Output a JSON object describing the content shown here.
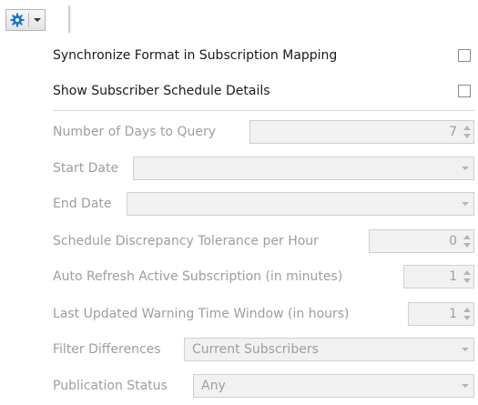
{
  "toolbar": {
    "gear_icon": "gear-icon",
    "dropdown_icon": "chevron-down-icon",
    "accent": "#1e73c8"
  },
  "options": {
    "sync_format": {
      "label": "Synchronize Format in Subscription Mapping",
      "checked": false
    },
    "show_schedule": {
      "label": "Show Subscriber Schedule Details",
      "checked": false
    }
  },
  "fields": {
    "days_to_query": {
      "label": "Number of Days to Query",
      "value": "7"
    },
    "start_date": {
      "label": "Start Date",
      "value": ""
    },
    "end_date": {
      "label": "End Date",
      "value": ""
    },
    "discrepancy_tolerance": {
      "label": "Schedule Discrepancy Tolerance per Hour",
      "value": "0"
    },
    "auto_refresh": {
      "label": "Auto Refresh Active Subscription (in minutes)",
      "value": "1"
    },
    "warning_window": {
      "label": "Last Updated Warning Time Window (in hours)",
      "value": "1"
    },
    "filter_differences": {
      "label": "Filter Differences",
      "value": "Current Subscribers"
    },
    "publication_status": {
      "label": "Publication Status",
      "value": "Any"
    }
  }
}
